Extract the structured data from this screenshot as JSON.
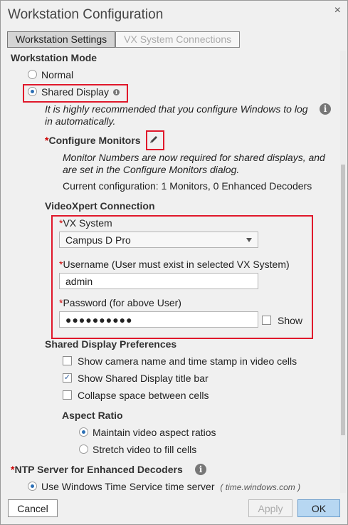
{
  "window": {
    "title": "Workstation Configuration",
    "close_glyph": "×"
  },
  "tabs": [
    {
      "label": "Workstation Settings",
      "active": true
    },
    {
      "label": "VX System Connections",
      "active": false
    }
  ],
  "workstation_mode": {
    "heading": "Workstation Mode",
    "options": [
      {
        "label": "Normal",
        "selected": false
      },
      {
        "label": "Shared Display",
        "selected": true
      }
    ],
    "recommendation": "It is highly recommended that you configure Windows to log in automatically."
  },
  "configure_monitors": {
    "required_mark": "*",
    "label": "Configure Monitors",
    "note": "Monitor Numbers are now required for shared displays, and are set in the Configure Monitors dialog.",
    "current_config": "Current configuration: 1 Monitors, 0 Enhanced Decoders"
  },
  "videoxpert": {
    "heading": "VideoXpert Connection",
    "vx_system": {
      "required_mark": "*",
      "label": "VX System",
      "value": "Campus D Pro"
    },
    "username": {
      "required_mark": "*",
      "label": "Username (User must exist in selected VX System)",
      "value": "admin"
    },
    "password": {
      "required_mark": "*",
      "label": "Password (for above User)",
      "value": "●●●●●●●●●●",
      "show_label": "Show",
      "show_checked": false
    }
  },
  "preferences": {
    "heading": "Shared Display Preferences",
    "items": [
      {
        "label": "Show camera name and time stamp in video cells",
        "checked": false
      },
      {
        "label": "Show Shared Display title bar",
        "checked": true
      },
      {
        "label": "Collapse space between cells",
        "checked": false
      }
    ]
  },
  "aspect_ratio": {
    "heading": "Aspect Ratio",
    "options": [
      {
        "label": "Maintain video aspect ratios",
        "selected": true
      },
      {
        "label": "Stretch video to fill cells",
        "selected": false
      }
    ]
  },
  "ntp": {
    "required_mark": "*",
    "heading": "NTP Server for Enhanced Decoders",
    "option_label": "Use Windows Time Service time server",
    "option_hint": "( time.windows.com )"
  },
  "footer": {
    "cancel": "Cancel",
    "apply": "Apply",
    "ok": "OK"
  },
  "colors": {
    "highlight": "#e0182b",
    "accent": "#2b6fb5",
    "ok_button": "#b7d7f2"
  }
}
